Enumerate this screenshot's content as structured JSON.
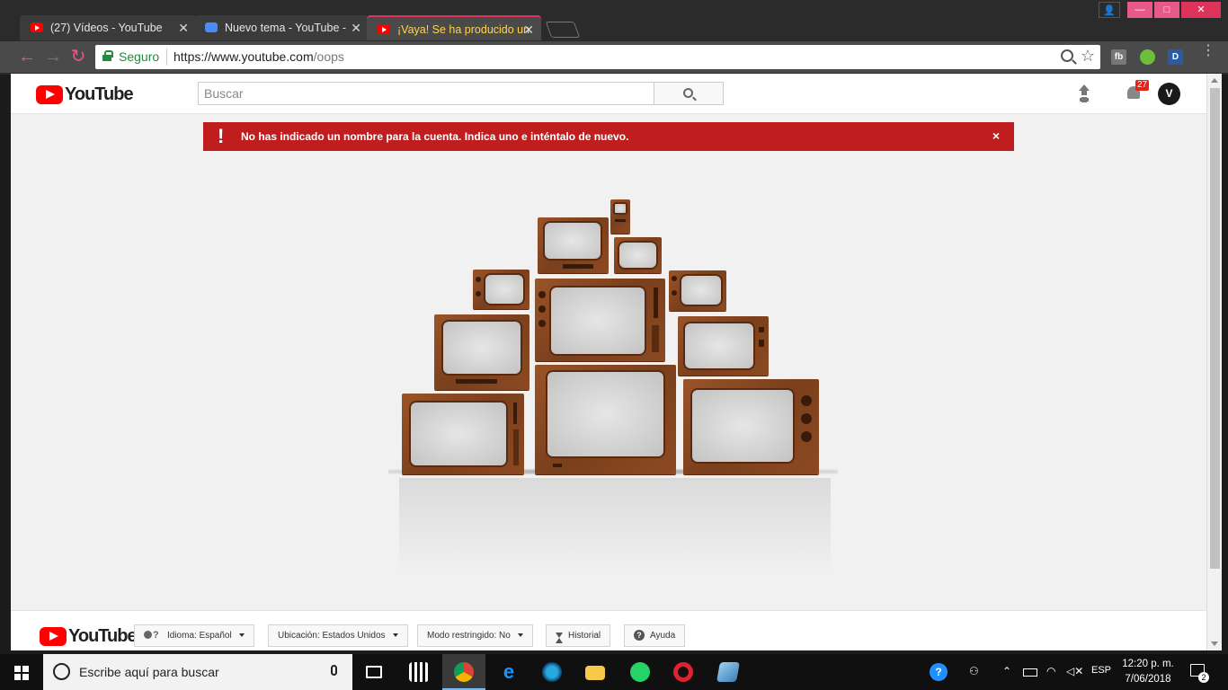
{
  "browser": {
    "tabs": [
      {
        "title": "(27) Vídeos - YouTube",
        "favicon": "youtube-icon"
      },
      {
        "title": "Nuevo tema - YouTube -",
        "favicon": "chat-icon"
      },
      {
        "title": "¡Vaya! Se ha producido un",
        "favicon": "youtube-icon",
        "active": true
      }
    ],
    "secure_label": "Seguro",
    "url_host": "https://www.youtube.com",
    "url_path": "/oops",
    "extensions": [
      "fb",
      "D"
    ]
  },
  "youtube": {
    "logo_text": "YouTube",
    "search_placeholder": "Buscar",
    "notification_count": "27",
    "avatar_letter": "V"
  },
  "alert": {
    "icon": "!",
    "message": "No has indicado un nombre para la cuenta. Indica uno e inténtalo de nuevo.",
    "close": "×"
  },
  "footer": {
    "logo_text": "YouTube",
    "language_label": "Idioma:",
    "language_value": "Español",
    "location_label": "Ubicación:",
    "location_value": "Estados Unidos",
    "restricted_label": "Modo restringido:",
    "restricted_value": "No",
    "history_label": "Historial",
    "help_label": "Ayuda"
  },
  "taskbar": {
    "search_placeholder": "Escribe aquí para buscar",
    "language": "ESP",
    "time": "12:20 p. m.",
    "date": "7/06/2018",
    "notification_count": "2"
  },
  "colors": {
    "alert_red": "#c01e1e",
    "youtube_red": "#ff0000",
    "chrome_dark": "#2b2b2b",
    "tab_active_accent": "#e0335c"
  }
}
